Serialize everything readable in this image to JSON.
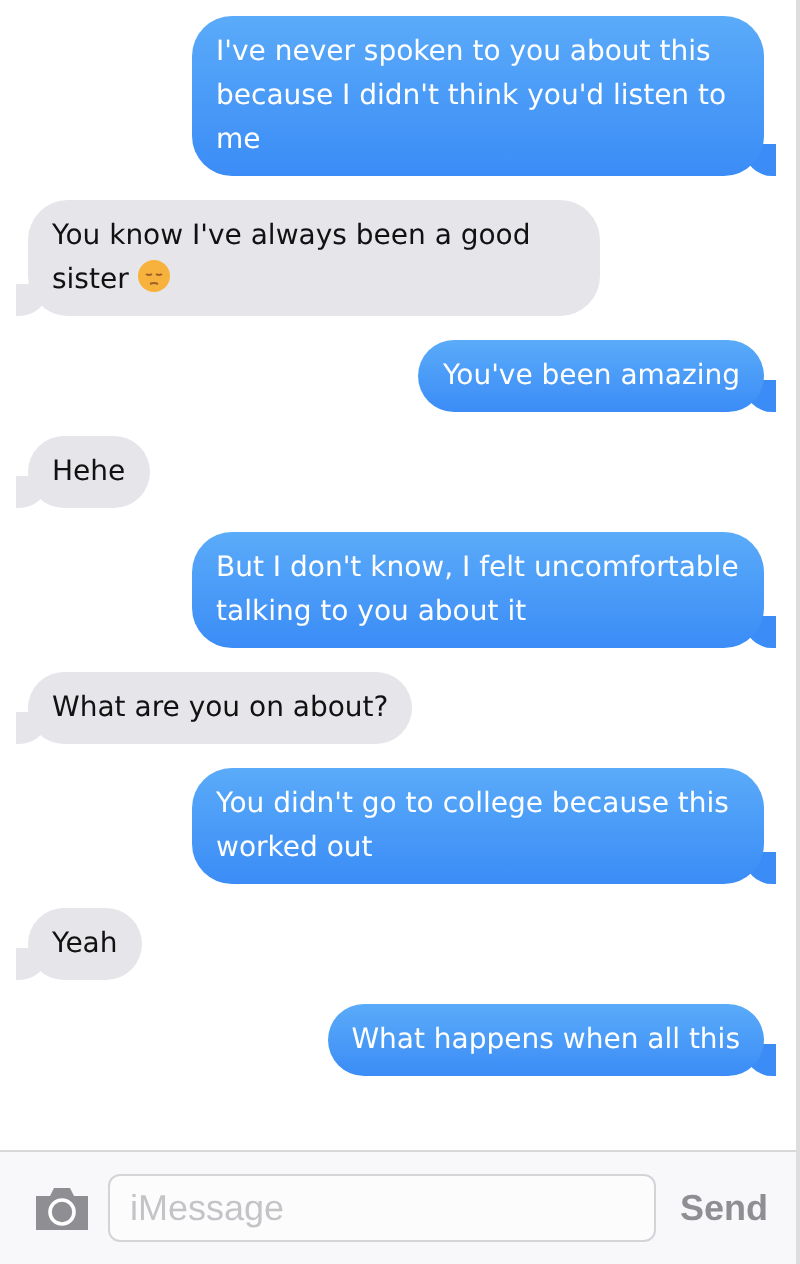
{
  "messages": [
    {
      "kind": "outgoing",
      "text": "I've never spoken to you about this because I didn't think you'd listen to me"
    },
    {
      "kind": "incoming",
      "text": "You know I've always been a good sister",
      "emoji": true
    },
    {
      "kind": "outgoing",
      "text": "You've been amazing"
    },
    {
      "kind": "incoming",
      "text": "Hehe"
    },
    {
      "kind": "outgoing",
      "text": "But I don't know, I felt uncomfortable talking to you about it"
    },
    {
      "kind": "incoming",
      "text": "What are you on about?"
    },
    {
      "kind": "outgoing",
      "text": "You didn't go to college because this worked out"
    },
    {
      "kind": "incoming",
      "text": "Yeah"
    },
    {
      "kind": "outgoing",
      "text": "What happens when all this"
    }
  ],
  "composer": {
    "placeholder": "iMessage",
    "send": "Send"
  }
}
